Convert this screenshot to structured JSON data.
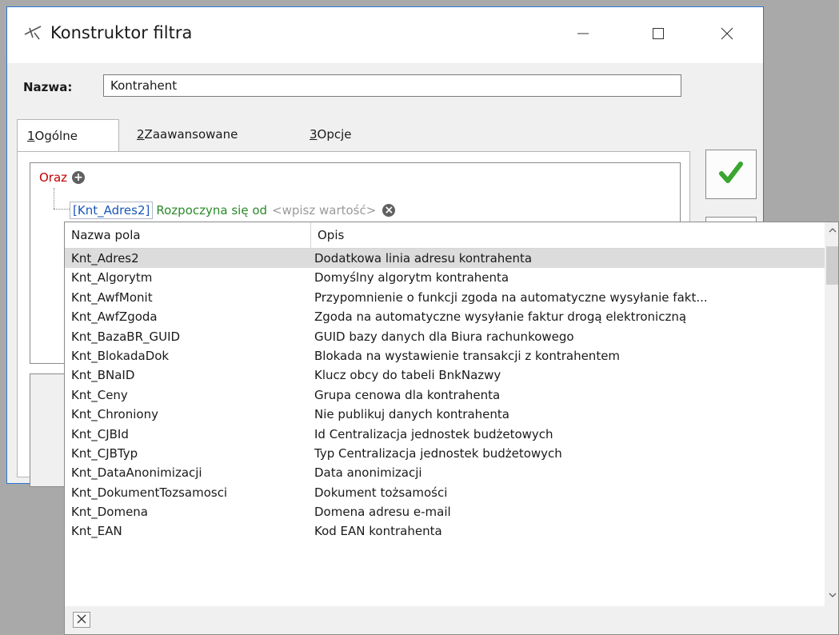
{
  "window": {
    "title": "Konstruktor filtra",
    "icon": "filter-tool-icon",
    "controls": [
      "minimize-icon",
      "maximize-icon",
      "close-icon"
    ]
  },
  "name_field": {
    "label": "Nazwa:",
    "value": "Kontrahent"
  },
  "tabs": [
    {
      "key": "1",
      "rest": " Ogólne",
      "active": true
    },
    {
      "key": "2",
      "rest": " Zaawansowane",
      "active": false
    },
    {
      "key": "3",
      "rest": " Opcje",
      "active": false
    }
  ],
  "filter_tree": {
    "root_operator": "Oraz",
    "condition": {
      "field": "[Knt_Adres2]",
      "operator": "Rozpoczyna się od",
      "value_placeholder": "<wpisz wartość>"
    }
  },
  "colors": {
    "root_operator": "#c00000",
    "field": "#1a57b8",
    "operator": "#2a8a2a",
    "placeholder": "#9a9a9a",
    "ok_check": "#3aa630",
    "window_border": "#2b78d8"
  },
  "field_list": {
    "columns": [
      "Nazwa pola",
      "Opis"
    ],
    "selected_index": 0,
    "rows": [
      [
        "Knt_Adres2",
        "Dodatkowa linia adresu kontrahenta"
      ],
      [
        "Knt_Algorytm",
        "Domyślny algorytm kontrahenta"
      ],
      [
        "Knt_AwfMonit",
        "Przypomnienie o funkcji zgoda na automatyczne wysyłanie fakt..."
      ],
      [
        "Knt_AwfZgoda",
        "Zgoda na automatyczne wysyłanie faktur drogą elektroniczną"
      ],
      [
        "Knt_BazaBR_GUID",
        "GUID bazy danych dla Biura rachunkowego"
      ],
      [
        "Knt_BlokadaDok",
        "Blokada na wystawienie transakcji z kontrahentem"
      ],
      [
        "Knt_BNaID",
        "Klucz obcy do tabeli BnkNazwy"
      ],
      [
        "Knt_Ceny",
        "Grupa cenowa dla kontrahenta"
      ],
      [
        "Knt_Chroniony",
        "Nie publikuj danych kontrahenta"
      ],
      [
        "Knt_CJBId",
        "Id Centralizacja jednostek budżetowych"
      ],
      [
        "Knt_CJBTyp",
        "Typ Centralizacja jednostek budżetowych"
      ],
      [
        "Knt_DataAnonimizacji",
        "Data anonimizacji"
      ],
      [
        "Knt_DokumentTozsamosci",
        "Dokument tożsamości"
      ],
      [
        "Knt_Domena",
        "Domena adresu e-mail"
      ],
      [
        "Knt_EAN",
        "Kod EAN kontrahenta"
      ]
    ]
  }
}
